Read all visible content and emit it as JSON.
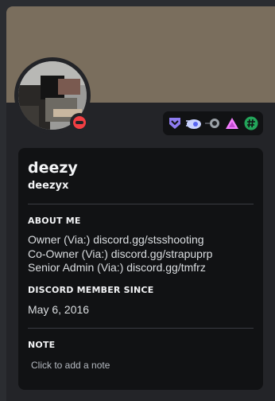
{
  "profile": {
    "display_name": "deezy",
    "username": "deezyx",
    "status": "do-not-disturb",
    "banner_color": "#7a6e5d"
  },
  "badges": [
    {
      "name": "hypesquad-balance-icon",
      "color": "#8e7cf0"
    },
    {
      "name": "nitro-icon",
      "color": "#c9d2ff"
    },
    {
      "name": "boost-icon",
      "color": "#9aa0a6"
    },
    {
      "name": "triangle-icon",
      "color": "#f47fff"
    },
    {
      "name": "hashtag-icon",
      "color": "#23a55a"
    }
  ],
  "about": {
    "title": "ABOUT ME",
    "lines": [
      "Owner (Via:) discord.gg/stsshooting",
      "Co-Owner (Via:) discord.gg/strapuprp",
      "Senior Admin (Via:) discord.gg/tmfrz"
    ]
  },
  "member_since": {
    "title": "DISCORD MEMBER SINCE",
    "date": "May 6, 2016"
  },
  "note": {
    "title": "NOTE",
    "placeholder": "Click to add a note"
  }
}
